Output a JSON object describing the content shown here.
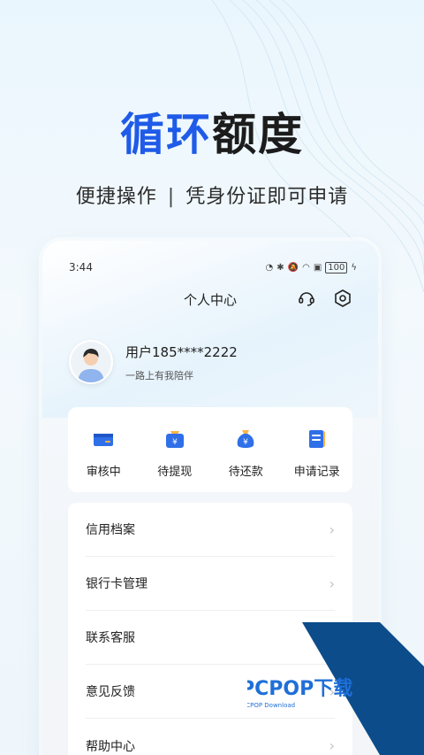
{
  "hero": {
    "title_accent": "循环",
    "title_rest": "额度",
    "subtitle_left": "便捷操作",
    "subtitle_sep": "|",
    "subtitle_right": "凭身份证即可申请"
  },
  "status_bar": {
    "time": "3:44",
    "battery": "100"
  },
  "nav": {
    "title": "个人中心",
    "support_icon": "headset-icon",
    "settings_icon": "gear-icon"
  },
  "profile": {
    "name": "用户185****2222",
    "motto": "一路上有我陪伴"
  },
  "quick_actions": [
    {
      "label": "审核中",
      "icon": "card-icon"
    },
    {
      "label": "待提现",
      "icon": "yuan-wallet-icon"
    },
    {
      "label": "待还款",
      "icon": "money-bag-icon"
    },
    {
      "label": "申请记录",
      "icon": "document-icon"
    }
  ],
  "menu": [
    {
      "label": "信用档案"
    },
    {
      "label": "银行卡管理"
    },
    {
      "label": "联系客服"
    },
    {
      "label": "意见反馈"
    },
    {
      "label": "帮助中心"
    }
  ],
  "watermark": {
    "brand": "PCPOP下载",
    "sub": "PCPOP Download"
  },
  "colors": {
    "accent": "#1f5be8",
    "watermark": "#0c4c8a"
  }
}
